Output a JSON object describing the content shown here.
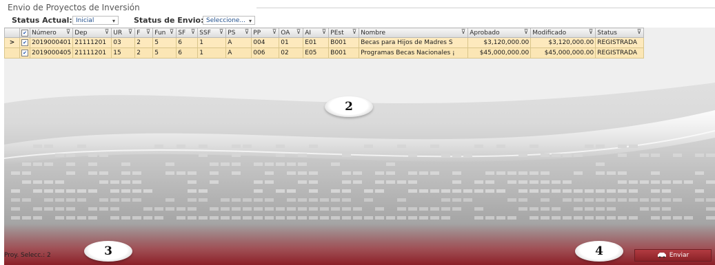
{
  "window_title": "Envio de Proyectos de Inversión",
  "filters": {
    "status_actual_label": "Status Actual:",
    "status_actual_value": "Inicial",
    "status_envio_label": "Status de Envio:",
    "status_envio_value": "Seleccione..."
  },
  "grid": {
    "columns": [
      "Número",
      "Dep",
      "UR",
      "F",
      "Fun",
      "SF",
      "SSF",
      "PS",
      "PP",
      "OA",
      "AI",
      "PEst",
      "Nombre",
      "Aprobado",
      "Modificado",
      "Status"
    ],
    "rows": [
      {
        "numero": "2019000401",
        "dep": "21111201",
        "ur": "03",
        "f": "2",
        "fun": "5",
        "sf": "6",
        "ssf": "1",
        "ps": "A",
        "pp": "004",
        "oa": "01",
        "ai": "E01",
        "pest": "B001",
        "nombre": "Becas para Hijos de Madres S",
        "aprobado": "$3,120,000.00",
        "modificado": "$3,120,000.00",
        "status": "REGISTRADA"
      },
      {
        "numero": "2019000405",
        "dep": "21111201",
        "ur": "15",
        "f": "2",
        "fun": "5",
        "sf": "6",
        "ssf": "1",
        "ps": "A",
        "pp": "006",
        "oa": "02",
        "ai": "E05",
        "pest": "B001",
        "nombre": "Programas Becas Nacionales ¡",
        "aprobado": "$45,000,000.00",
        "modificado": "$45,000,000.00",
        "status": "REGISTRADA"
      }
    ]
  },
  "row_pointer": ">",
  "callouts": {
    "c2": "2",
    "c3": "3",
    "c4": "4"
  },
  "status_bar": {
    "selected_label": "Proy. Selecc.: 2"
  },
  "buttons": {
    "send_label": "Enviar"
  },
  "colors": {
    "row_bg": "#fde9bd",
    "accent_red": "#a3323a"
  }
}
